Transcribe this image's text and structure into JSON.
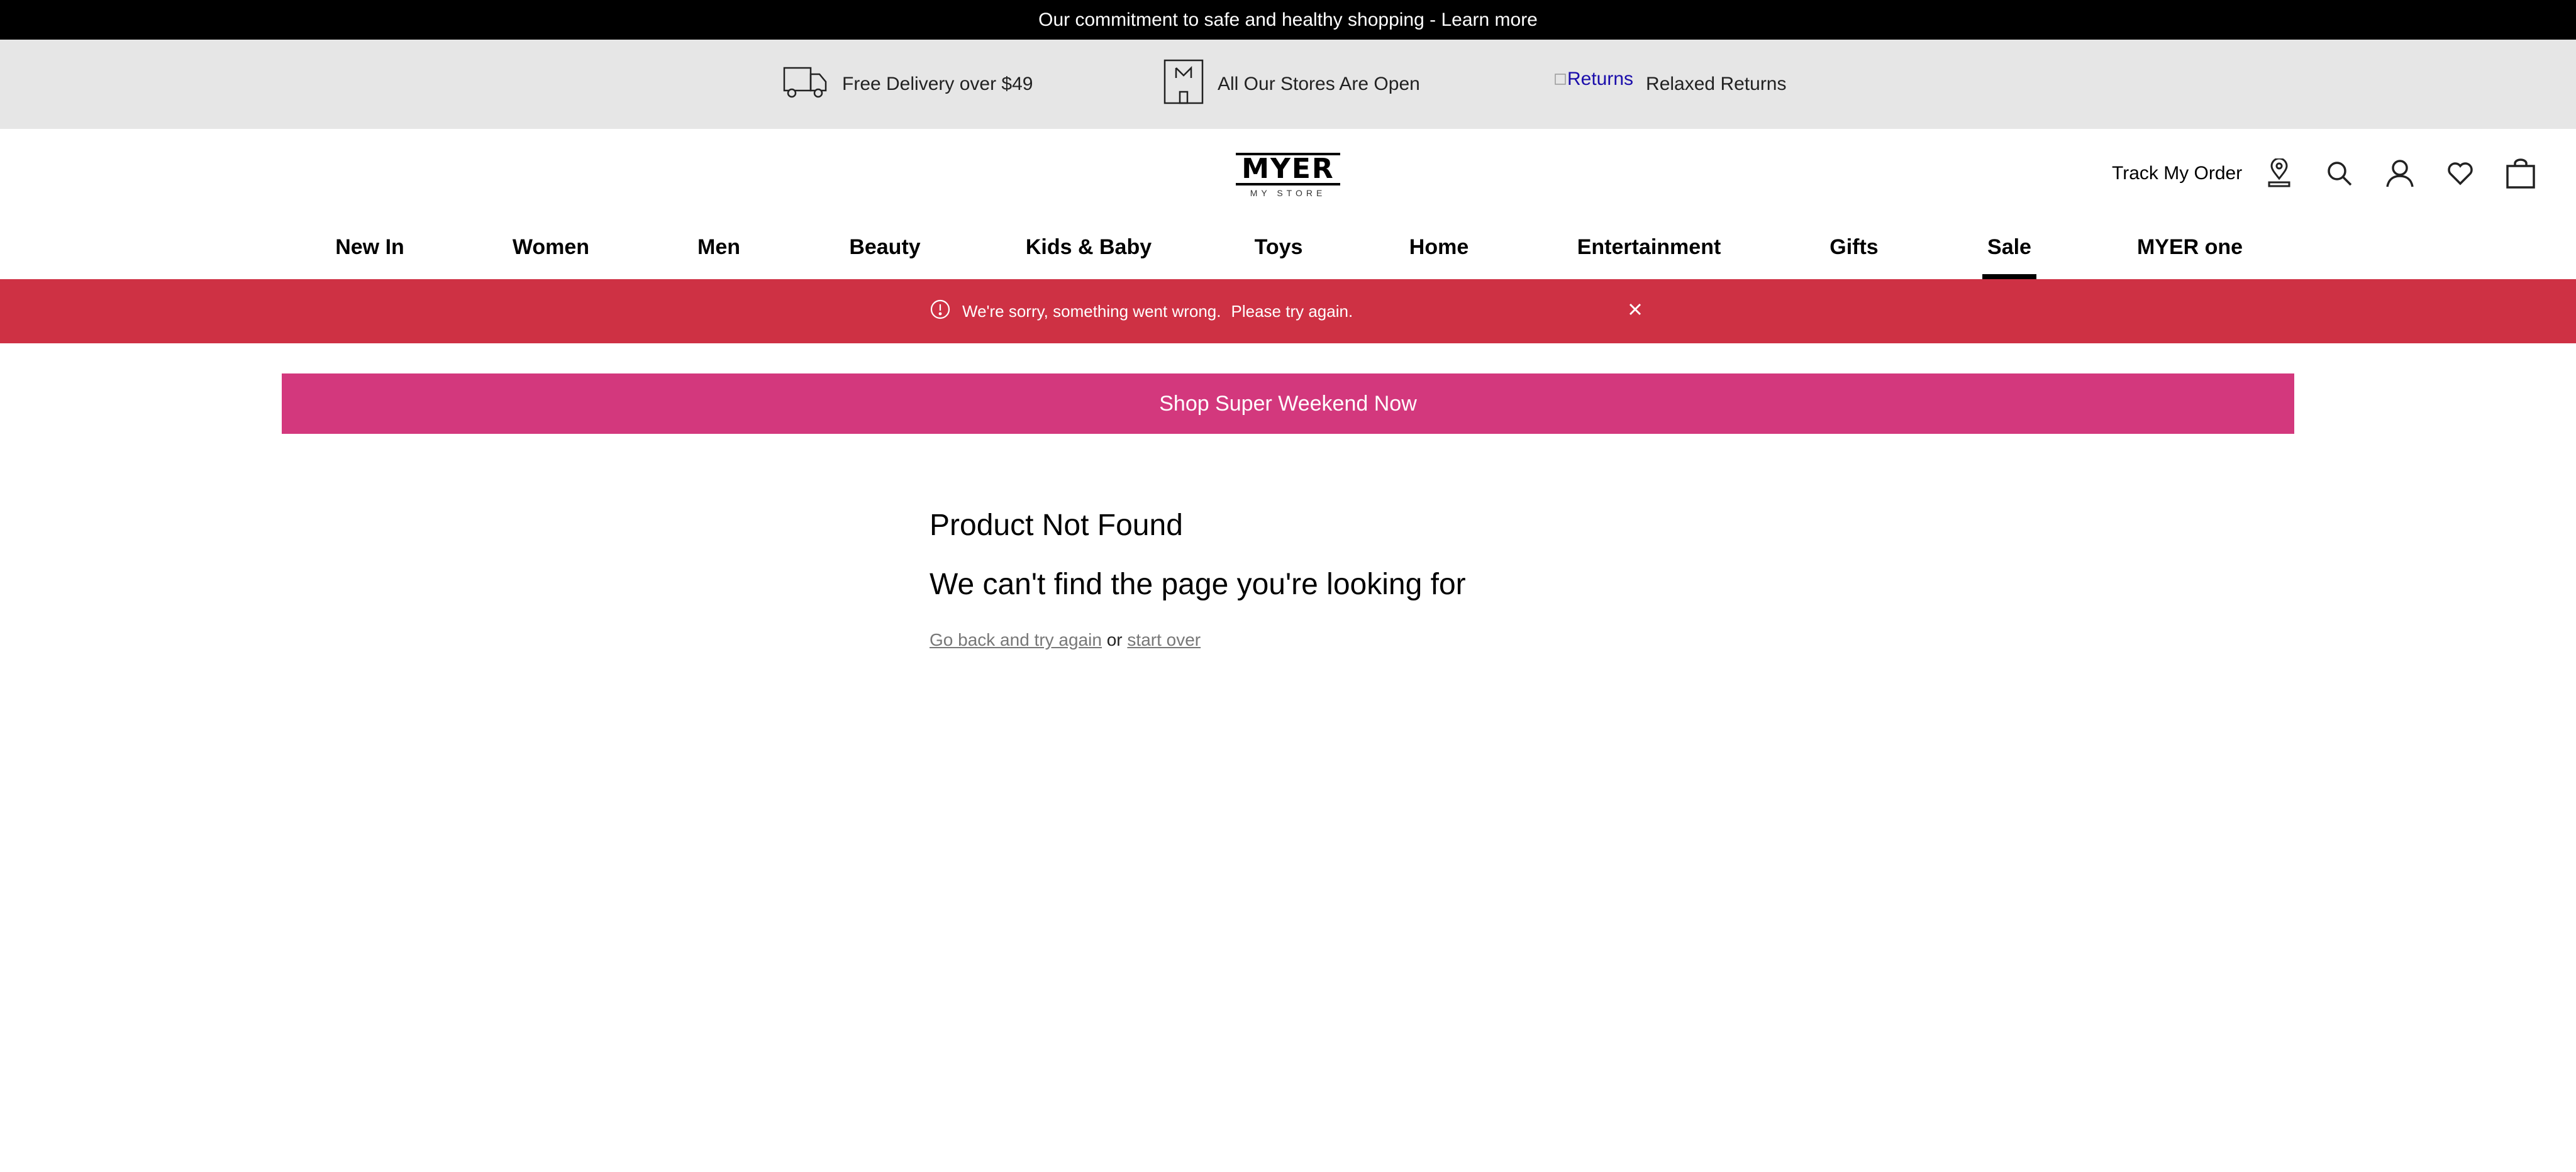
{
  "announcement": {
    "text": "Our commitment to safe and healthy shopping - Learn more"
  },
  "usp": {
    "items": [
      {
        "icon": "truck-icon",
        "label": "Free Delivery over $49"
      },
      {
        "icon": "store-icon",
        "label": "All Our Stores Are Open"
      },
      {
        "icon": "returns-image",
        "alt": "Returns",
        "label": "Relaxed Returns"
      }
    ]
  },
  "logo": {
    "main": "MYER",
    "sub": "MY STORE"
  },
  "header": {
    "track_order": "Track My Order",
    "icons": [
      "store-locator-icon",
      "search-icon",
      "account-icon",
      "wishlist-heart-icon",
      "shopping-bag-icon"
    ]
  },
  "nav": {
    "items": [
      {
        "label": "New In"
      },
      {
        "label": "Women"
      },
      {
        "label": "Men"
      },
      {
        "label": "Beauty"
      },
      {
        "label": "Kids & Baby"
      },
      {
        "label": "Toys"
      },
      {
        "label": "Home"
      },
      {
        "label": "Entertainment"
      },
      {
        "label": "Gifts"
      },
      {
        "label": "Sale",
        "active": true
      },
      {
        "label": "MYER one"
      }
    ]
  },
  "error": {
    "line1": "We're sorry, something went wrong.",
    "line2": "Please try again.",
    "color": "#ce3144"
  },
  "promo": {
    "label": "Shop Super Weekend Now",
    "color": "#d3387d"
  },
  "content": {
    "title": "Product Not Found",
    "subtitle": "We can't find the page you're looking for",
    "link_back": "Go back and try again",
    "or_text": "or",
    "link_start": "start over"
  }
}
